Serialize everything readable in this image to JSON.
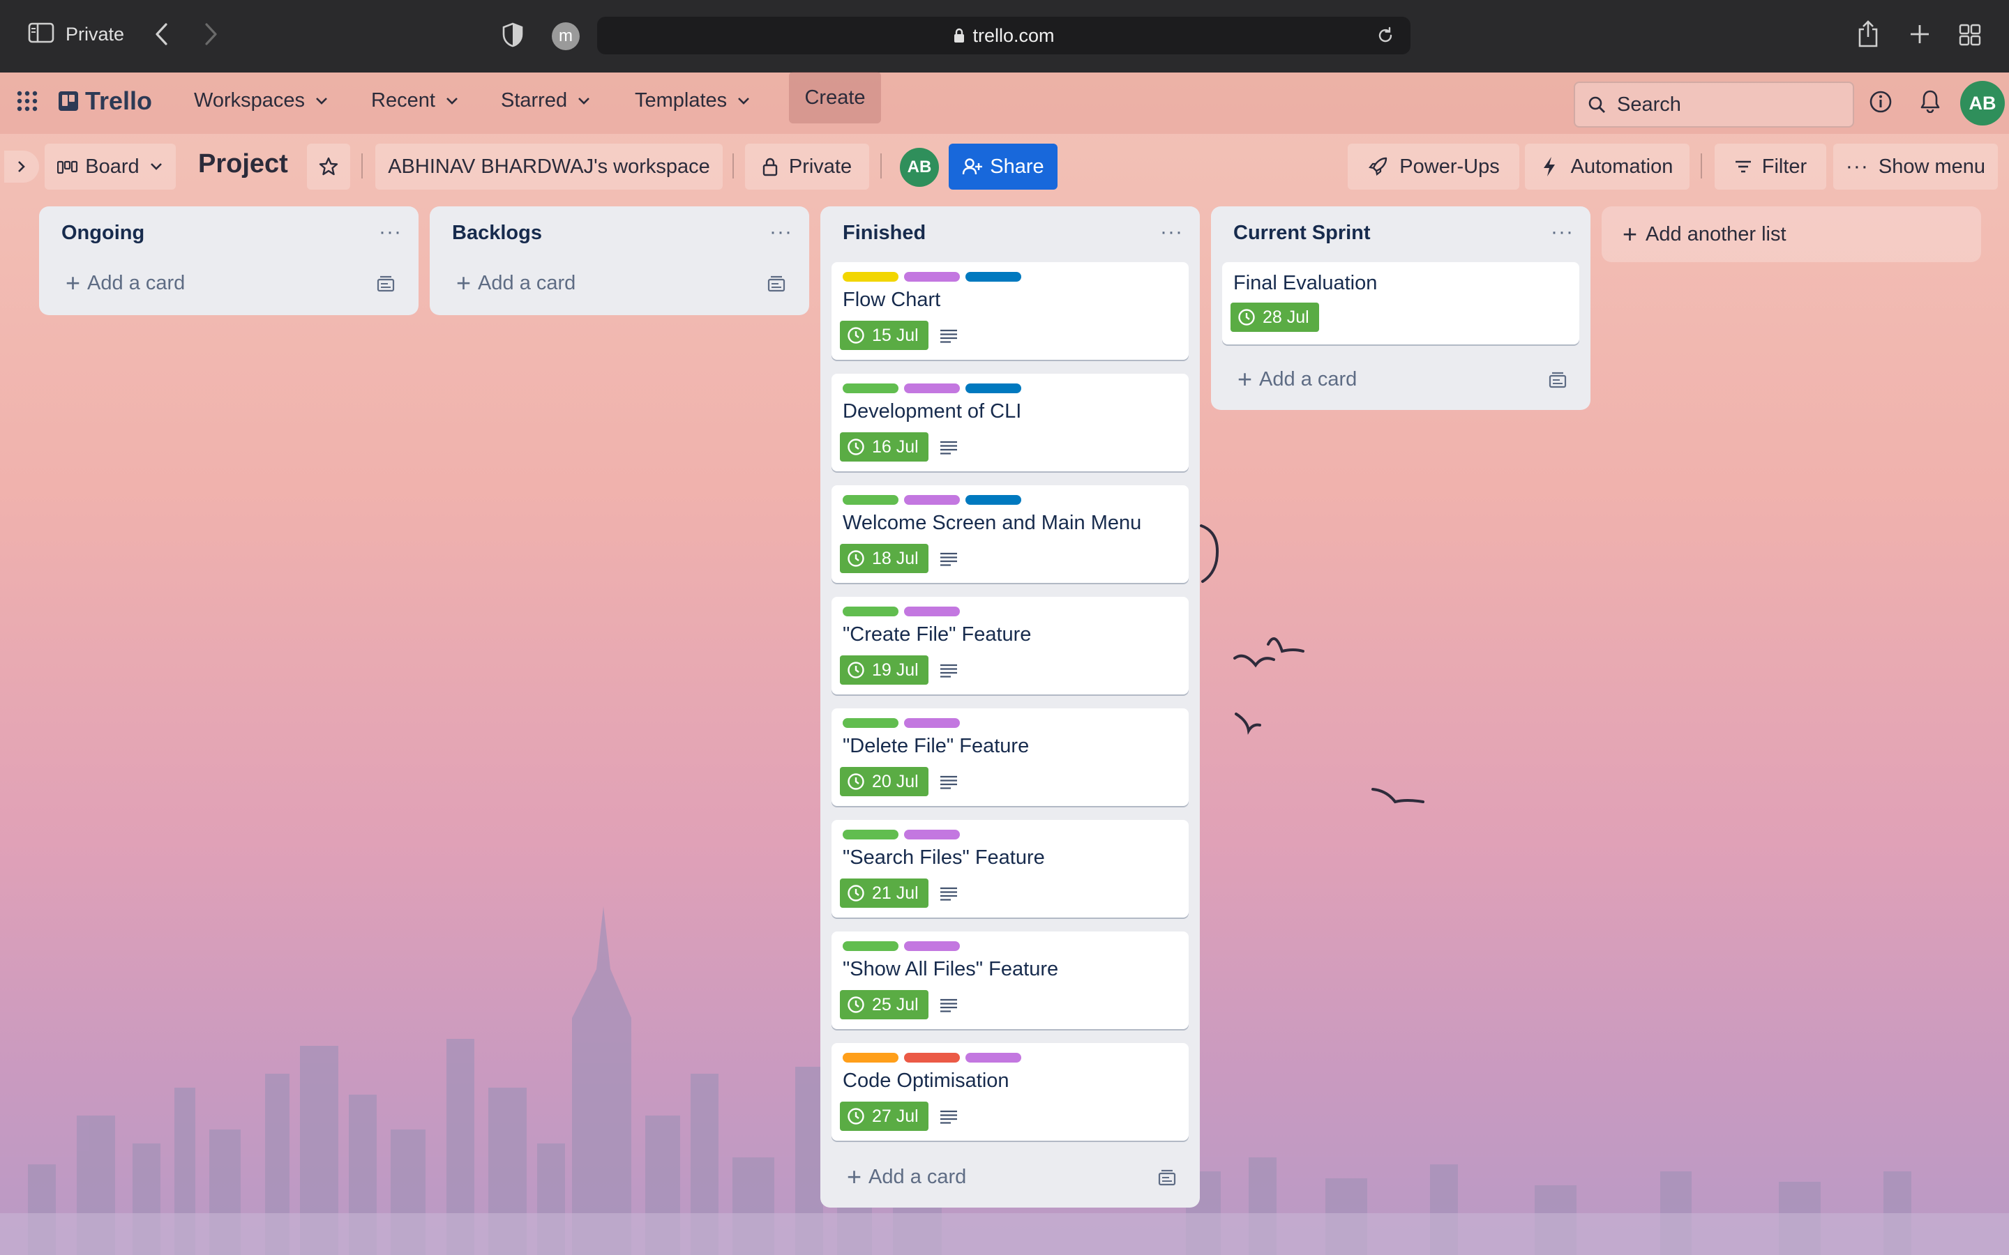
{
  "browser": {
    "private_label": "Private",
    "url": "trello.com",
    "profile_initial": "m"
  },
  "header": {
    "logo": "Trello",
    "nav": [
      {
        "label": "Workspaces"
      },
      {
        "label": "Recent"
      },
      {
        "label": "Starred"
      },
      {
        "label": "Templates"
      }
    ],
    "create_label": "Create",
    "search_placeholder": "Search",
    "avatar_initials": "AB"
  },
  "board": {
    "view_label": "Board",
    "title": "Project",
    "workspace_label": "ABHINAV BHARDWAJ's workspace",
    "visibility_label": "Private",
    "member_initials": "AB",
    "share_label": "Share",
    "powerups_label": "Power-Ups",
    "automation_label": "Automation",
    "filter_label": "Filter",
    "show_menu_label": "Show menu",
    "add_list_label": "Add another list"
  },
  "colors": {
    "yellow": "#f2d600",
    "purple": "#c377e0",
    "blue": "#0079bf",
    "green": "#61bd4f",
    "orange": "#ff9f1a",
    "red": "#eb5a46",
    "due_green": "#5aac44",
    "share_blue": "#1868db"
  },
  "lists": [
    {
      "title": "Ongoing",
      "add_card_label": "Add a card",
      "cards": []
    },
    {
      "title": "Backlogs",
      "add_card_label": "Add a card",
      "cards": []
    },
    {
      "title": "Finished",
      "add_card_label": "Add a card",
      "cards": [
        {
          "title": "Flow Chart",
          "due": "15 Jul",
          "labels": [
            "yellow",
            "purple",
            "blue"
          ],
          "has_description": true
        },
        {
          "title": "Development of CLI",
          "due": "16 Jul",
          "labels": [
            "green",
            "purple",
            "blue"
          ],
          "has_description": true
        },
        {
          "title": "Welcome Screen and Main Menu",
          "due": "18 Jul",
          "labels": [
            "green",
            "purple",
            "blue"
          ],
          "has_description": true
        },
        {
          "title": "\"Create File\" Feature",
          "due": "19 Jul",
          "labels": [
            "green",
            "purple"
          ],
          "has_description": true
        },
        {
          "title": "\"Delete File\" Feature",
          "due": "20 Jul",
          "labels": [
            "green",
            "purple"
          ],
          "has_description": true
        },
        {
          "title": "\"Search Files\" Feature",
          "due": "21 Jul",
          "labels": [
            "green",
            "purple"
          ],
          "has_description": true
        },
        {
          "title": "\"Show All Files\" Feature",
          "due": "25 Jul",
          "labels": [
            "green",
            "purple"
          ],
          "has_description": true
        },
        {
          "title": "Code Optimisation",
          "due": "27 Jul",
          "labels": [
            "orange",
            "red",
            "purple"
          ],
          "has_description": true
        }
      ]
    },
    {
      "title": "Current Sprint",
      "add_card_label": "Add a card",
      "cards": [
        {
          "title": "Final Evaluation",
          "due": "28 Jul",
          "labels": [],
          "has_description": false
        }
      ]
    }
  ]
}
